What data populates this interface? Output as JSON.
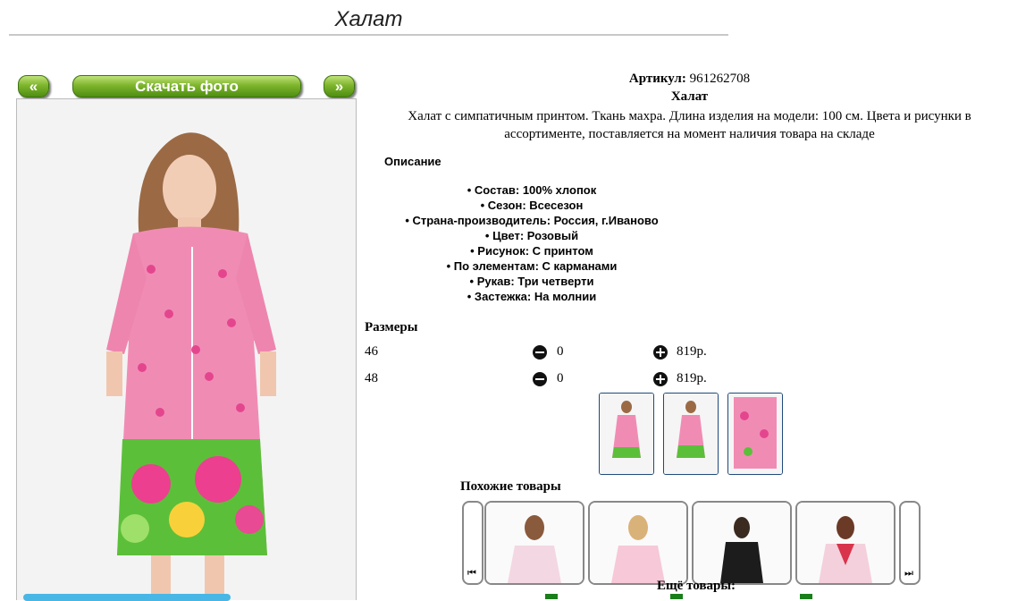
{
  "page": {
    "title": "Халат"
  },
  "gallery": {
    "prev_label": "«",
    "download_label": "Скачать фото",
    "next_label": "»"
  },
  "product": {
    "article_label": "Артикул:",
    "article_value": "961262708",
    "name": "Халат",
    "description": "Халат с симпатичным принтом. Ткань махра. Длина изделия на модели: 100 см. Цвета и рисунки в ассортименте, поставляется на момент наличия товара на складе",
    "description_heading": "Описание",
    "properties": [
      "Состав: 100% хлопок",
      "Сезон: Всесезон",
      "Страна-производитель: Россия, г.Иваново",
      "Цвет: Розовый",
      "Рисунок: С принтом",
      "По элементам: С карманами",
      "Рукав: Три четверти",
      "Застежка: На молнии"
    ]
  },
  "sizes": {
    "heading": "Размеры",
    "rows": [
      {
        "size": "46",
        "qty": "0",
        "price": "819р."
      },
      {
        "size": "48",
        "qty": "0",
        "price": "819р."
      }
    ]
  },
  "similar": {
    "heading": "Похожие товары",
    "prev_icon": "step-back-icon",
    "next_icon": "step-forward-icon"
  },
  "more": {
    "heading": "Ещё товары:"
  },
  "colors": {
    "button_green": "#6aa620",
    "dress_pink": "#f08cb4",
    "thumb_border": "#1f4a7a",
    "link_green": "#1a7f1a"
  }
}
